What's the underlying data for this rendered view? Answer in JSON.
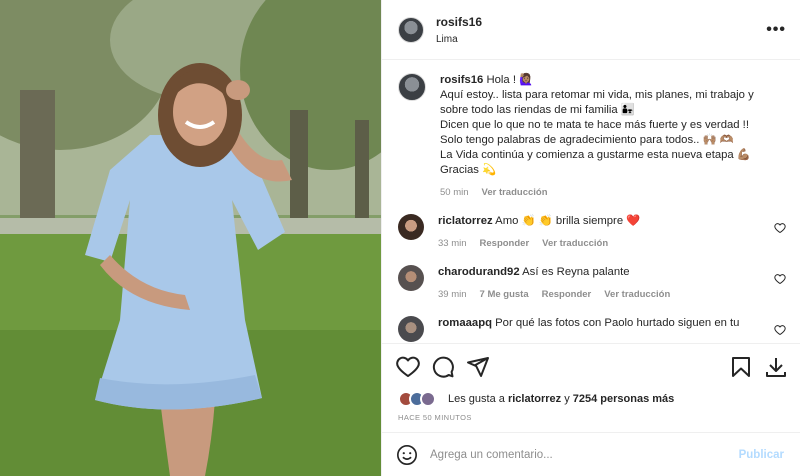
{
  "post": {
    "username": "rosifs16",
    "location": "Lima",
    "more_icon": "more-horizontal-icon",
    "caption_lines": [
      "Aquí estoy.. lista para retomar mi vida, mis planes, mi trabajo y",
      "sobre todo las riendas de mi familia 👨‍👧",
      "Dicen que lo que no te mata te hace más fuerte y es verdad !!",
      "Solo tengo palabras de agradecimiento para todos.. 🙌🏽 🫶🏽",
      "La Vida continúa y comienza a gustarme esta nueva etapa 💪🏽",
      "Gracias 💫"
    ],
    "caption_first": "Hola ! 🙋🏽‍♀️",
    "caption_time": "50 min",
    "see_translation": "Ver traducción"
  },
  "comments": [
    {
      "user": "riclatorrez",
      "text": "Amo 👏 👏 brilla siempre ❤️",
      "time": "33 min",
      "reply": "Responder",
      "translate": "Ver traducción",
      "likes": ""
    },
    {
      "user": "charodurand92",
      "text": "Así es Reyna palante",
      "time": "39 min",
      "likes": "7 Me gusta",
      "reply": "Responder",
      "translate": "Ver traducción"
    },
    {
      "user": "romaaapq",
      "text": "Por qué las fotos con Paolo hurtado siguen en tu"
    }
  ],
  "likes": {
    "prefix": "Les gusta a",
    "user": "riclatorrez",
    "connector": "y",
    "count": "7254 personas más"
  },
  "timestamp": "HACE 50 MINUTOS",
  "composer": {
    "placeholder": "Agrega un comentario...",
    "publish": "Publicar"
  },
  "colors": {
    "accent_disabled": "#b3dbff",
    "heart": "#ed4956",
    "muted": "#8e8e8e"
  }
}
